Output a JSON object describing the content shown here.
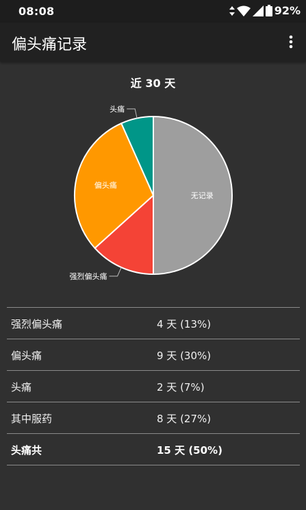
{
  "status_bar": {
    "time": "08:08",
    "battery": "92%",
    "icons": [
      "data-arrows-icon",
      "wifi-icon",
      "signal-icon",
      "battery-icon"
    ]
  },
  "app_bar": {
    "title": "偏头痛记录",
    "menu_icon": "more-vert-icon"
  },
  "chart_data": {
    "type": "pie",
    "title": "近 30 天",
    "slices": [
      {
        "label": "无记录",
        "value": 15,
        "color": "#9e9e9e",
        "label_inside": true
      },
      {
        "label": "强烈偏头痛",
        "value": 4,
        "color": "#f44336",
        "label_inside": false
      },
      {
        "label": "偏头痛",
        "value": 9,
        "color": "#ff9800",
        "label_inside": true
      },
      {
        "label": "头痛",
        "value": 2,
        "color": "#009688",
        "label_inside": false
      }
    ]
  },
  "stats": [
    {
      "label": "强烈偏头痛",
      "value": "4 天  (13%)",
      "bold": false
    },
    {
      "label": "偏头痛",
      "value": "9 天  (30%)",
      "bold": false
    },
    {
      "label": "头痛",
      "value": "2 天  (7%)",
      "bold": false
    },
    {
      "label": "其中服药",
      "value": "8 天  (27%)",
      "bold": false
    },
    {
      "label": "头痛共",
      "value": "15 天  (50%)",
      "bold": true
    }
  ]
}
